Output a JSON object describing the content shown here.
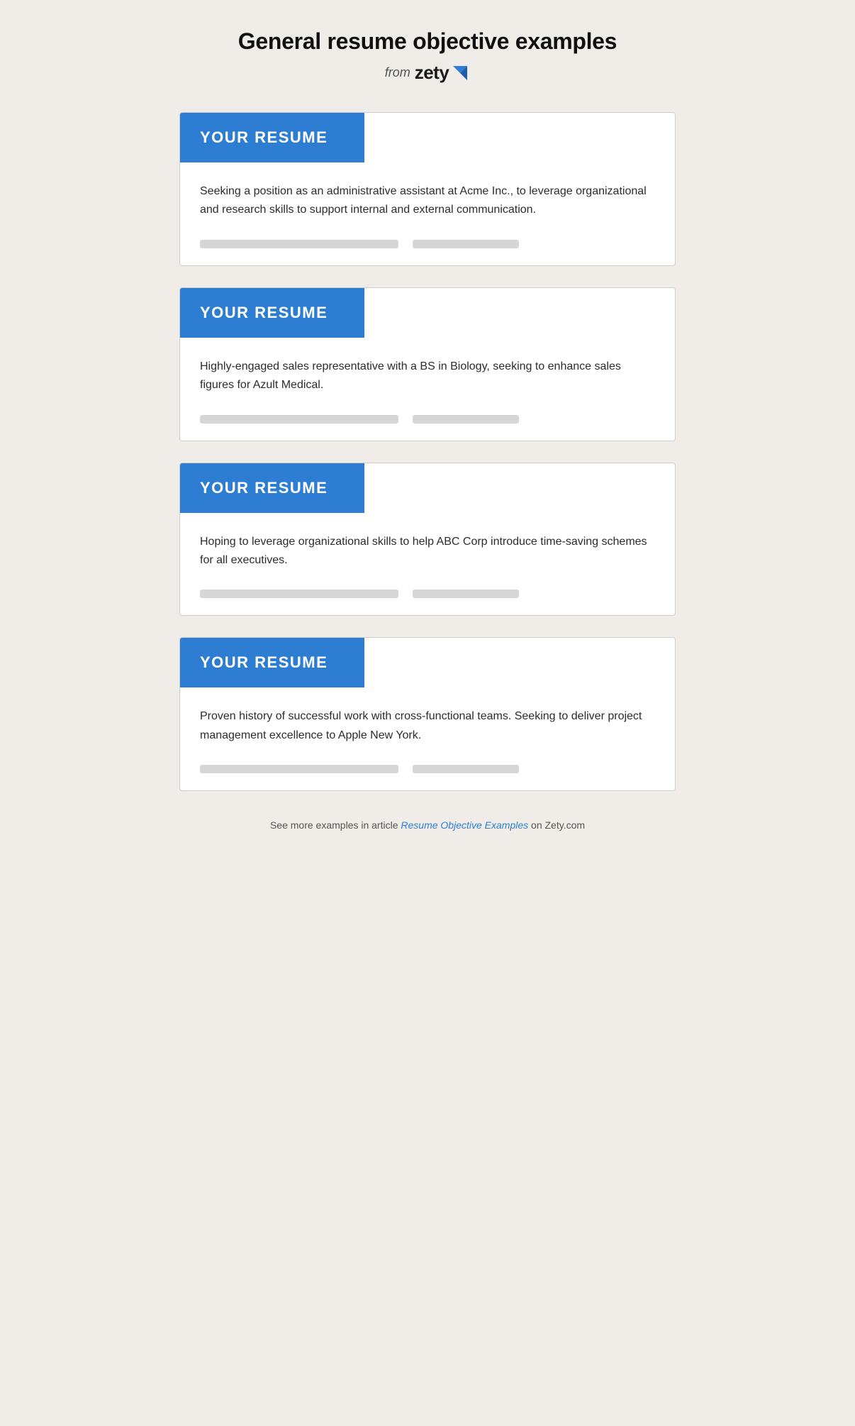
{
  "page": {
    "title": "General resume objective examples",
    "brand_from": "from",
    "brand_name": "zety",
    "footer_prefix": "See more examples in article ",
    "footer_link_text": "Resume Objective Examples",
    "footer_suffix": " on Zety.com"
  },
  "cards": [
    {
      "id": "card-1",
      "header_label": "YOUR RESUME",
      "objective_text": "Seeking a position as an administrative assistant at Acme Inc., to leverage organizational and research skills to support internal and external communication."
    },
    {
      "id": "card-2",
      "header_label": "YOUR RESUME",
      "objective_text": "Highly-engaged sales representative with a BS in Biology, seeking to enhance sales figures for Azult Medical."
    },
    {
      "id": "card-3",
      "header_label": "YOUR RESUME",
      "objective_text": "Hoping to leverage organizational skills to help ABC Corp introduce time-saving schemes for all executives."
    },
    {
      "id": "card-4",
      "header_label": "YOUR RESUME",
      "objective_text": "Proven history of successful work with cross-functional teams. Seeking to deliver project management excellence to Apple New York."
    }
  ]
}
